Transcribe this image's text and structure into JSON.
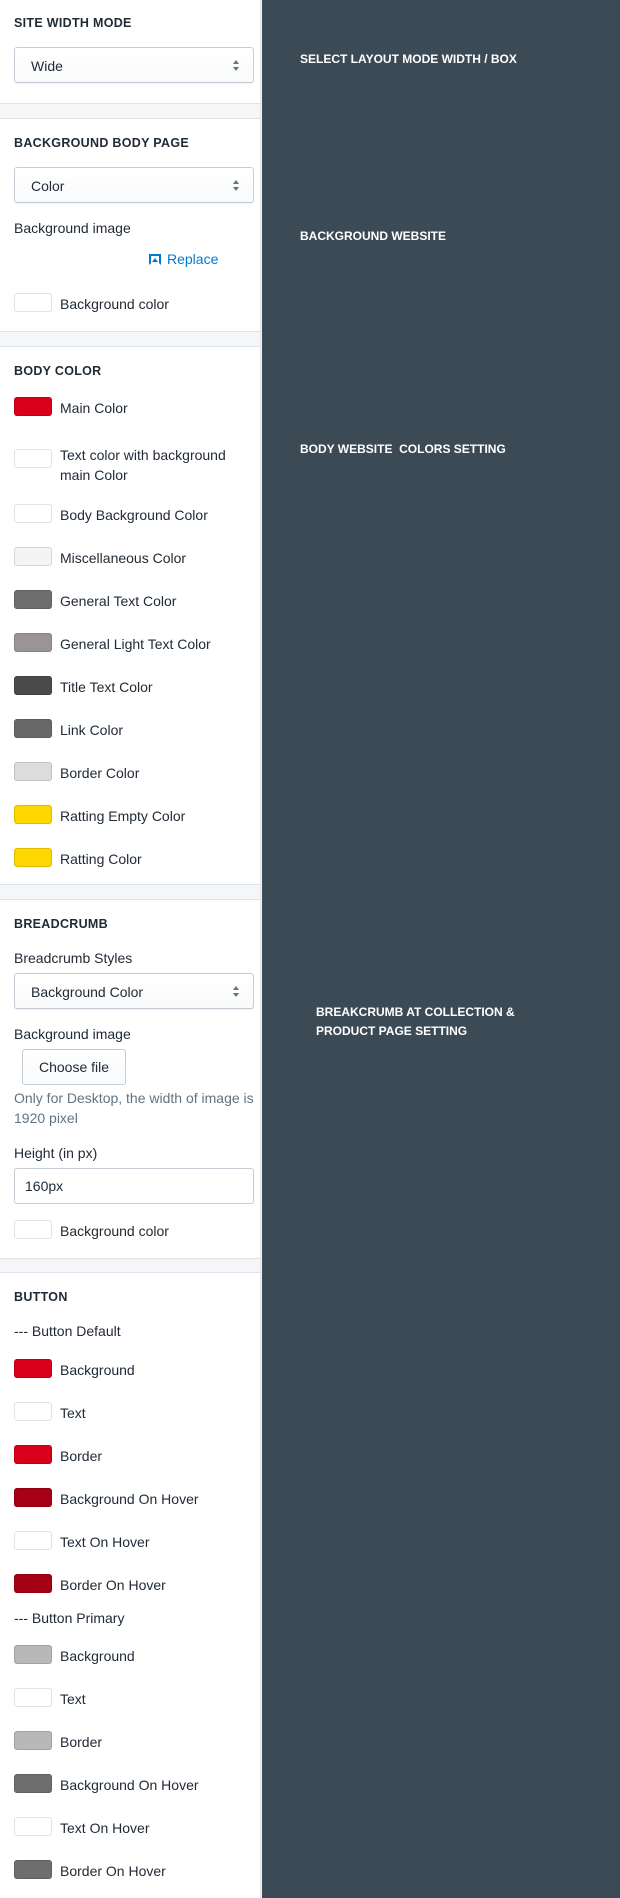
{
  "site_width": {
    "heading": "SITE WIDTH MODE",
    "select_value": "Wide"
  },
  "background_body": {
    "heading": "BACKGROUND BODY PAGE",
    "select_value": "Color",
    "image_label": "Background image",
    "replace_label": "Replace",
    "color_label": "Background color",
    "color_value": "#ffffff"
  },
  "body_color": {
    "heading": "BODY COLOR",
    "items": [
      {
        "label": "Main Color",
        "color": "#d9001b"
      },
      {
        "label": "Text color with background main Color",
        "color": "#ffffff"
      },
      {
        "label": "Body Background Color",
        "color": "#ffffff"
      },
      {
        "label": "Miscellaneous Color",
        "color": "#f4f4f4"
      },
      {
        "label": "General Text Color",
        "color": "#6e6e6e"
      },
      {
        "label": "General Light Text Color",
        "color": "#9a9499"
      },
      {
        "label": "Title Text Color",
        "color": "#4a4a4a"
      },
      {
        "label": "Link Color",
        "color": "#686868"
      },
      {
        "label": "Border Color",
        "color": "#dcdcdc"
      },
      {
        "label": "Ratting Empty Color",
        "color": "#ffd600"
      },
      {
        "label": "Ratting Color",
        "color": "#ffd600"
      }
    ]
  },
  "breadcrumb": {
    "heading": "BREADCRUMB",
    "styles_label": "Breadcrumb Styles",
    "select_value": "Background Color",
    "image_label": "Background image",
    "choose_file": "Choose file",
    "help": "Only for Desktop, the width of image is 1920 pixel",
    "height_label": "Height (in px)",
    "height_value": "160px",
    "color_label": "Background color",
    "color_value": "#ffffff"
  },
  "button": {
    "heading": "BUTTON",
    "default_label": "--- Button Default",
    "default_items": [
      {
        "label": "Background",
        "color": "#d9001b"
      },
      {
        "label": "Text",
        "color": "#ffffff"
      },
      {
        "label": "Border",
        "color": "#d9001b"
      },
      {
        "label": "Background On Hover",
        "color": "#a50014"
      },
      {
        "label": "Text On Hover",
        "color": "#ffffff"
      },
      {
        "label": "Border On Hover",
        "color": "#a50014"
      }
    ],
    "primary_label": "--- Button Primary",
    "primary_items": [
      {
        "label": "Background",
        "color": "#b8b8b8"
      },
      {
        "label": "Text",
        "color": "#ffffff"
      },
      {
        "label": "Border",
        "color": "#b8b8b8"
      },
      {
        "label": "Background On Hover",
        "color": "#6e6e6e"
      },
      {
        "label": "Text On Hover",
        "color": "#ffffff"
      },
      {
        "label": "Border On Hover",
        "color": "#6e6e6e"
      }
    ]
  },
  "annotations": {
    "site_width": "SELECT LAYOUT MODE WIDTH / BOX",
    "background": "BACKGROUND WEBSITE",
    "body_colors": "BODY WEBSITE  COLORS SETTING",
    "breadcrumb_line1": "BREAKCRUMB AT COLLECTION &",
    "breadcrumb_line2": "PRODUCT PAGE SETTING"
  },
  "colors": {
    "dark_panel": "#3c4a55",
    "link": "#007ace"
  }
}
